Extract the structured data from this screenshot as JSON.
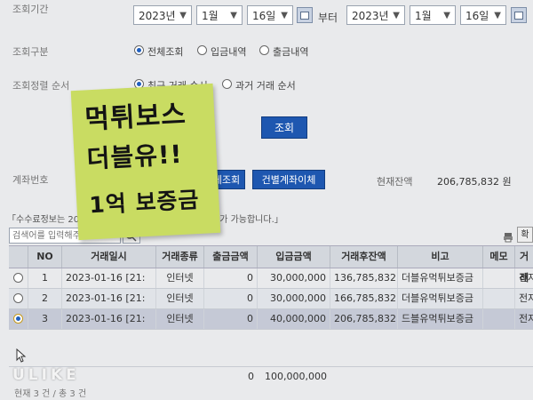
{
  "period": {
    "label": "조회기간",
    "from": {
      "year": "2023년",
      "month": "1월",
      "day": "16일"
    },
    "to_label": "부터",
    "to": {
      "year": "2023년",
      "month": "1월",
      "day": "16일"
    }
  },
  "query_type": {
    "label": "조회구분",
    "options": [
      "전체조회",
      "입금내역",
      "출금내역"
    ],
    "selected": 0
  },
  "sort": {
    "label": "조회정렬 순서",
    "options": [
      "최근 거래 순서",
      "과거 거래 순서"
    ],
    "selected": 0
  },
  "search_button": "조회",
  "account": {
    "label": "계좌번호",
    "btn_detail": "체조회",
    "btn_transfer": "건별계좌이체",
    "balance_label": "현재잔액",
    "balance_value": "206,785,832 원"
  },
  "notice": {
    "left": "「수수료정보는 20",
    "right": "회가 가능합니다.」"
  },
  "search": {
    "placeholder": "검색어를 입력해주세요"
  },
  "toolbar": {
    "print_icon": "printer-icon",
    "extra": "확"
  },
  "table": {
    "headers": [
      "NO",
      "거래일시",
      "거래종류",
      "출금금액",
      "입금금액",
      "거래후잔액",
      "비고",
      "메모",
      "거래"
    ],
    "rows": [
      {
        "no": "1",
        "date": "2023-01-16 [21:",
        "type": "인터넷",
        "out": "0",
        "in": "30,000,000",
        "balance": "136,785,832",
        "note": "더블유먹튀보증금",
        "memo": "",
        "extra": "전자"
      },
      {
        "no": "2",
        "date": "2023-01-16 [21:",
        "type": "인터넷",
        "out": "0",
        "in": "30,000,000",
        "balance": "166,785,832",
        "note": "더블유먹튀보증금",
        "memo": "",
        "extra": "전자"
      },
      {
        "no": "3",
        "date": "2023-01-16 [21:",
        "type": "인터넷",
        "out": "0",
        "in": "40,000,000",
        "balance": "206,785,832",
        "note": "드블유먹튀보증금",
        "memo": "",
        "extra": "전자"
      }
    ],
    "selected_row": 2,
    "totals": {
      "out": "0",
      "in": "100,000,000"
    }
  },
  "count_text": "현재 3 건 / 총 3 건",
  "sticky_note": {
    "lines": [
      "먹튀보스",
      "더블유!!",
      "1억 보증금"
    ]
  },
  "watermark": "ULIKE",
  "colors": {
    "accent": "#1e57b0",
    "note": "#c9dc62"
  }
}
